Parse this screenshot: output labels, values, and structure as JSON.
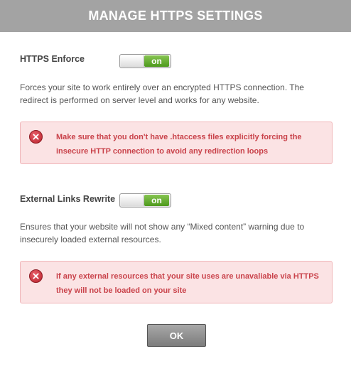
{
  "dialog": {
    "title": "MANAGE HTTPS SETTINGS"
  },
  "settings": [
    {
      "label": "HTTPS Enforce",
      "toggle_state": "on",
      "description": "Forces your site to work entirely over an encrypted HTTPS connection. The redirect is performed on server level and works for any website.",
      "warning_icon": "error-icon",
      "warning": "Make sure that you don't have .htaccess files explicitly forcing the insecure HTTP connection to avoid any redirection loops"
    },
    {
      "label": "External Links Rewrite",
      "toggle_state": "on",
      "description": "Ensures that your website will not show any “Mixed content” warning due to insecurely loaded external resources.",
      "warning_icon": "error-icon",
      "warning": "If any external resources that your site uses are unavaliable via HTTPS they will not be loaded on your site"
    }
  ],
  "footer": {
    "ok_label": "OK"
  },
  "colors": {
    "header": "#a3a3a3",
    "toggle_on": "#5fa82c",
    "alert_background": "#fbe3e4",
    "alert_text": "#c9424a",
    "error_icon": "#c8313b"
  }
}
